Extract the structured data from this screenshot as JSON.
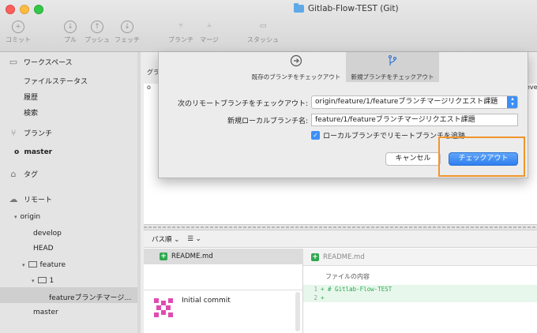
{
  "window": {
    "title": "Gitlab-Flow-TEST (Git)"
  },
  "toolbar": {
    "commit": "コミット",
    "pull": "プル",
    "push": "プッシュ",
    "fetch": "フェッチ",
    "branch": "ブランチ",
    "merge": "マージ",
    "stash": "スタッシュ"
  },
  "sidebar": {
    "workspace": "ワークスペース",
    "file_status": "ファイルステータス",
    "history": "履歴",
    "search": "検索",
    "branches": "ブランチ",
    "master": "master",
    "tags": "タグ",
    "remotes": "リモート",
    "origin": "origin",
    "develop": "develop",
    "head": "HEAD",
    "feature": "feature",
    "folder_1": "1",
    "feature_branch": "featureブランチマージ…",
    "origin_master": "master"
  },
  "behind": {
    "graph_label": "グラ",
    "right_fragment": "eve"
  },
  "dialog": {
    "tab_existing": "既存のブランチをチェックアウト",
    "tab_new": "新規ブランチをチェックアウト",
    "remote_label": "次のリモートブランチをチェックアウト:",
    "remote_value": "origin/feature/1/featureブランチマージリクエスト課題",
    "local_label": "新規ローカルブランチ名:",
    "local_value": "feature/1/featureブランチマージリクエスト課題",
    "track_label": "ローカルブランチでリモートブランチを追跡",
    "cancel": "キャンセル",
    "checkout": "チェックアウト"
  },
  "lower": {
    "sort": "パス順",
    "file_name": "README.md",
    "diff_file": "README.md",
    "hunk": "ファイルの内容",
    "diff_lines": [
      {
        "num": "1",
        "text": "+ # Gitlab-Flow-TEST"
      },
      {
        "num": "2",
        "text": "+"
      }
    ],
    "commit_message": "Initial commit"
  },
  "colors": {
    "accent": "#3d8ff5",
    "highlight": "#f0952a",
    "added": "#2fa84f"
  }
}
